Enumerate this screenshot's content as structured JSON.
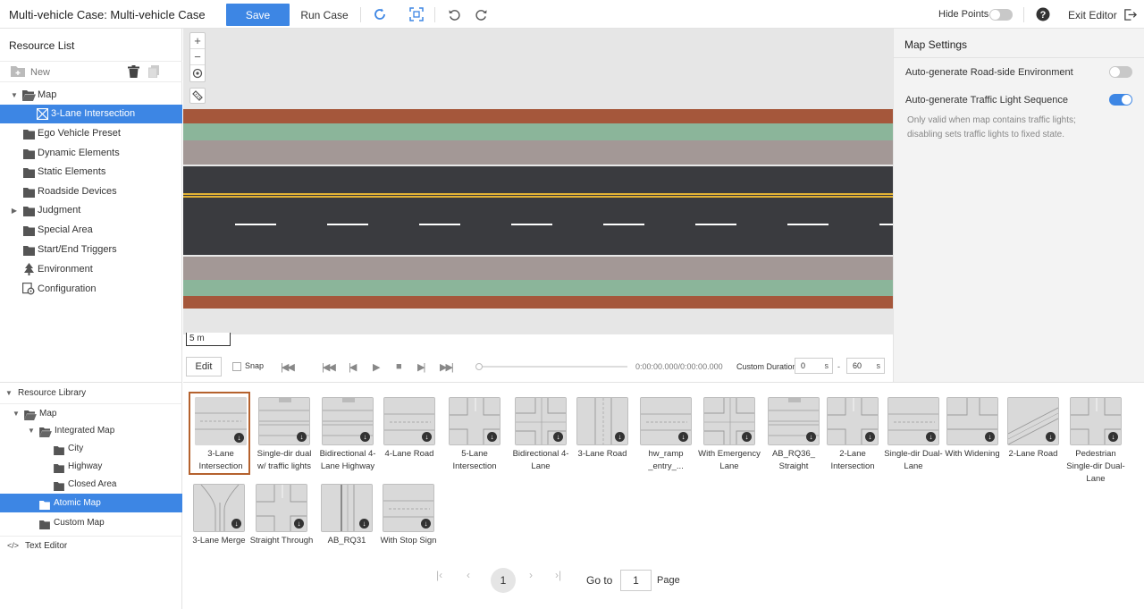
{
  "header": {
    "title": "Multi-vehicle Case: Multi-vehicle Case",
    "save_label": "Save",
    "run_label": "Run Case",
    "hide_points_label": "Hide Points",
    "hide_points_on": false,
    "exit_label": "Exit Editor"
  },
  "resource_list": {
    "title": "Resource List",
    "new_label": "New",
    "items": [
      {
        "label": "Map",
        "expanded": true,
        "icon": "folder-open-icon"
      },
      {
        "label": "3-Lane Intersection",
        "selected": true,
        "icon": "intersection-icon"
      },
      {
        "label": "Ego Vehicle Preset",
        "icon": "folder-icon"
      },
      {
        "label": "Dynamic Elements",
        "icon": "folder-icon"
      },
      {
        "label": "Static Elements",
        "icon": "folder-icon"
      },
      {
        "label": "Roadside Devices",
        "icon": "folder-icon"
      },
      {
        "label": "Judgment",
        "collapsed": true,
        "icon": "folder-icon"
      },
      {
        "label": "Special Area",
        "icon": "folder-icon"
      },
      {
        "label": "Start/End Triggers",
        "icon": "folder-icon"
      },
      {
        "label": "Environment",
        "icon": "tree-icon"
      },
      {
        "label": "Configuration",
        "icon": "settings-icon"
      }
    ]
  },
  "map": {
    "scale_label": "5 m",
    "colors": {
      "brick": "#a5573b",
      "green": "#8bb59a",
      "sidewalk": "#a39896",
      "asphalt": "#3a3b3f",
      "yellow": "#e2b235",
      "ground": "#e6e6e6"
    }
  },
  "playback": {
    "edit_label": "Edit",
    "snap_label": "Snap",
    "timecode": "0:00:00.000/0:00:00.000",
    "custom_duration_label": "Custom Duration",
    "start_value": "0",
    "end_value": "60",
    "unit": "s",
    "separator": "-"
  },
  "map_settings": {
    "title": "Map Settings",
    "option1_label": "Auto-generate Road-side Environment",
    "option1_on": false,
    "option2_label": "Auto-generate Traffic Light Sequence",
    "option2_on": true,
    "note": "Only valid when map contains traffic lights; disabling sets traffic lights to fixed state."
  },
  "resource_library": {
    "title": "Resource Library",
    "items": [
      {
        "label": "Map"
      },
      {
        "label": "Integrated Map"
      },
      {
        "label": "City"
      },
      {
        "label": "Highway"
      },
      {
        "label": "Closed Area"
      },
      {
        "label": "Atomic Map",
        "selected": true
      },
      {
        "label": "Custom Map"
      }
    ],
    "text_editor_label": "Text Editor"
  },
  "cards": [
    {
      "label": "3-Lane Intersection",
      "selected": true,
      "thumb": "straight"
    },
    {
      "label": "Single-dir dual w/ traffic lights",
      "thumb": "dual"
    },
    {
      "label": "Bidirectional 4-Lane Highway",
      "thumb": "dual"
    },
    {
      "label": "4-Lane Road",
      "thumb": "straight"
    },
    {
      "label": "5-Lane Intersection",
      "thumb": "cross"
    },
    {
      "label": "Bidirectional 4-Lane",
      "thumb": "cross4"
    },
    {
      "label": "3-Lane Road",
      "thumb": "vertical"
    },
    {
      "label": "hw_ramp _entry_...",
      "thumb": "straight"
    },
    {
      "label": "With Emergency Lane",
      "thumb": "cross4"
    },
    {
      "label": "AB_RQ36_ Straight",
      "thumb": "dual"
    },
    {
      "label": "2-Lane Intersection",
      "thumb": "cross"
    },
    {
      "label": "Single-dir Dual-Lane",
      "thumb": "straight"
    },
    {
      "label": "With Widening",
      "thumb": "tee"
    },
    {
      "label": "2-Lane Road",
      "thumb": "diagonal"
    },
    {
      "label": "Pedestrian Single-dir Dual-Lane",
      "thumb": "cross"
    },
    {
      "label": "3-Lane Merge",
      "thumb": "merge"
    },
    {
      "label": "Straight Through",
      "thumb": "cross"
    },
    {
      "label": "AB_RQ31",
      "thumb": "vertical2"
    },
    {
      "label": "With Stop Sign",
      "thumb": "straight"
    }
  ],
  "pagination": {
    "current": "1",
    "goto_label": "Go to",
    "goto_value": "1",
    "page_label": "Page"
  }
}
